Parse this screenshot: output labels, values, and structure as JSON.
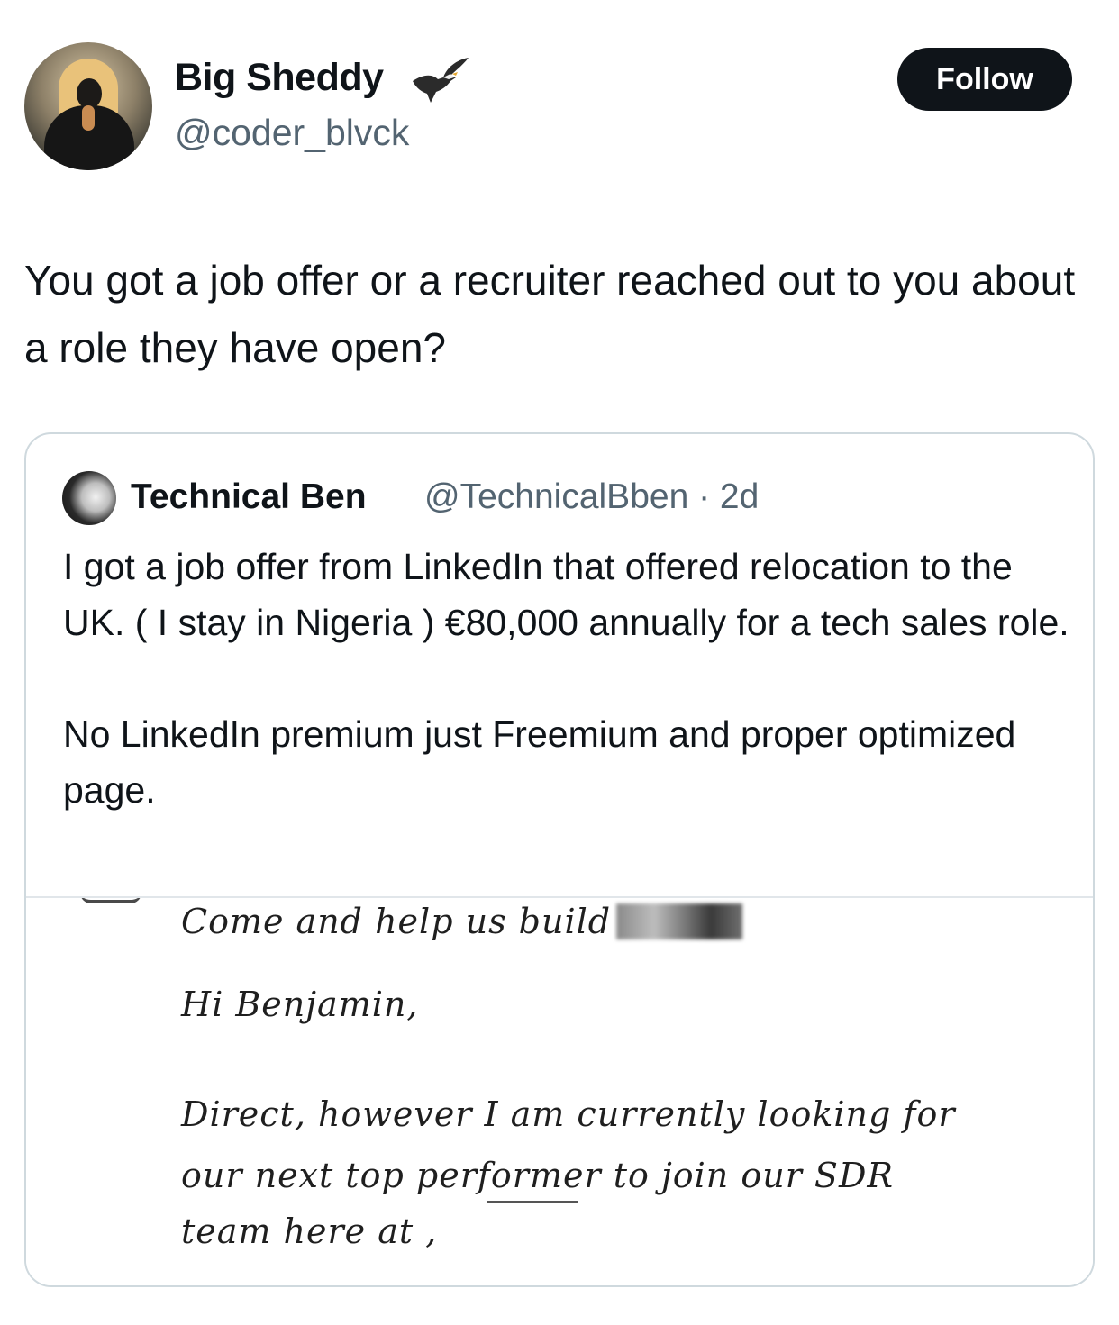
{
  "author": {
    "name": "Big Sheddy",
    "handle": "@coder_blvck",
    "badge_icon": "eagle-icon"
  },
  "follow_label": "Follow",
  "tweet": {
    "text": "You got a job offer or a recruiter reached out to you about a role they have open?"
  },
  "quote": {
    "name": "Technical Ben",
    "handle_time": "@TechnicalBben · 2d",
    "text": "I got a job offer from LinkedIn that offered relocation to the UK. ( I stay in Nigeria ) €80,000 annually for a tech sales role.\n\nNo LinkedIn premium just Freemium and proper optimized page.",
    "image": {
      "line1": "Come and help us build",
      "line2": "Hi Benjamin,",
      "line3": "Direct, however I am currently looking for",
      "line4": "our next top performer to join our SDR",
      "line5": "team here at ,"
    }
  },
  "colors": {
    "text": "#0f1419",
    "secondary": "#536471",
    "border": "#cfd9de",
    "button_bg": "#0f1419"
  }
}
